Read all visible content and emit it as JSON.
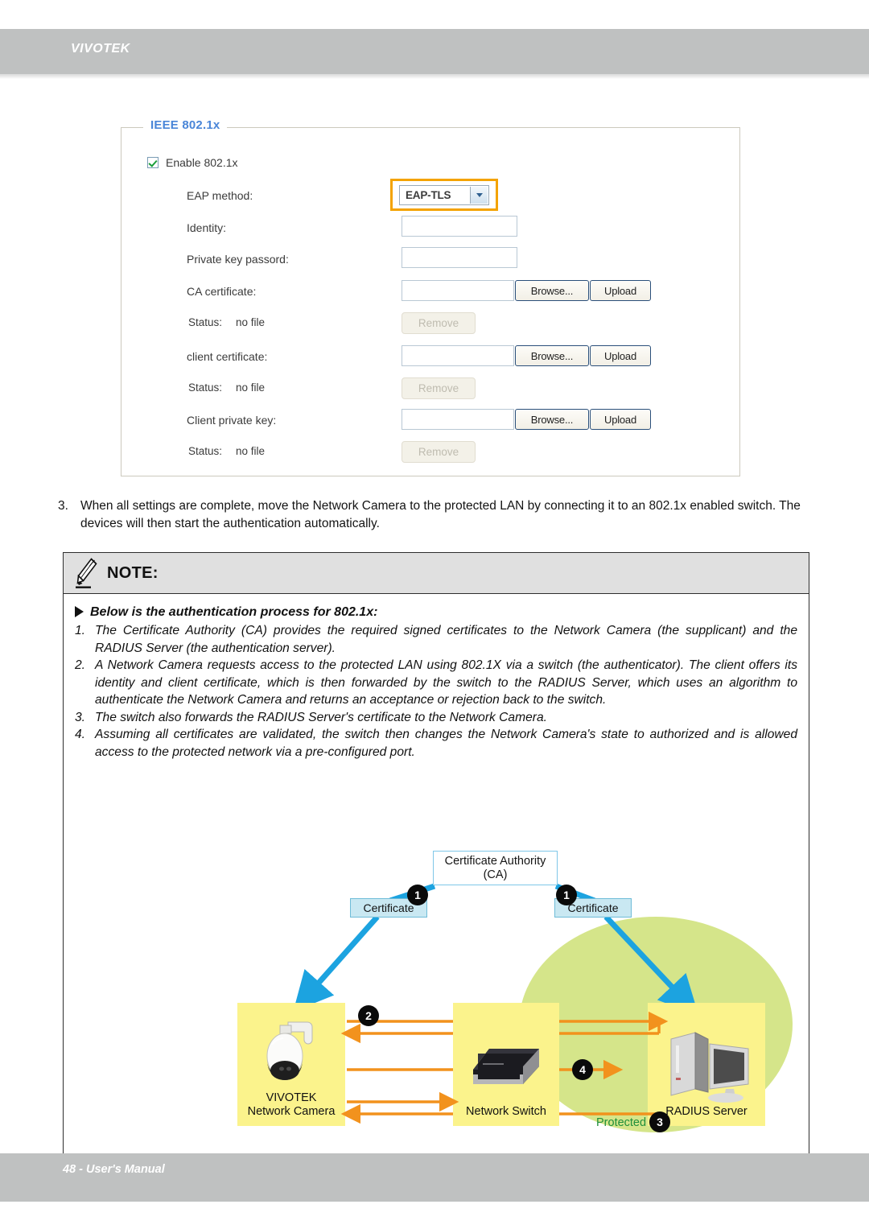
{
  "header": {
    "brand": "VIVOTEK"
  },
  "footer": {
    "text": "48 - User's Manual"
  },
  "settings": {
    "legend": "IEEE 802.1x",
    "enable_label": "Enable 802.1x",
    "enable_checked": true,
    "fields": {
      "eap_method_label": "EAP method:",
      "eap_method_value": "EAP-TLS",
      "identity_label": "Identity:",
      "identity_value": "",
      "private_key_label": "Private key passord:",
      "private_key_value": "",
      "ca_cert_label": "CA certificate:",
      "ca_cert_value": "",
      "client_cert_label": "client certificate:",
      "client_cert_value": "",
      "client_key_label": "Client private key:",
      "client_key_value": ""
    },
    "status_label": "Status:",
    "status_value": "no file",
    "buttons": {
      "browse": "Browse...",
      "upload": "Upload",
      "remove": "Remove"
    },
    "highlight_color": "#f4a300",
    "legend_color": "#4a86d8"
  },
  "step3": {
    "number": "3.",
    "text": "When all settings are complete, move the Network Camera to the protected LAN by connecting it to an 802.1x enabled switch. The devices will then start the authentication automatically."
  },
  "note": {
    "title": "NOTE:",
    "intro": "Below is the authentication process for 802.1x:",
    "items": [
      {
        "num": "1.",
        "text": "The Certificate Authority (CA) provides the required signed certificates to the Network Camera (the supplicant) and the RADIUS Server (the authentication server)."
      },
      {
        "num": "2.",
        "text": "A Network Camera requests access to the protected LAN using 802.1X via a switch (the authenticator). The client offers its identity and client certificate, which is then forwarded by the switch to the RADIUS Server, which uses an algorithm to authenticate the Network Camera and returns an acceptance or rejection back to the switch."
      },
      {
        "num": "3.",
        "text": "The switch also forwards the RADIUS Server's certificate to the Network Camera."
      },
      {
        "num": "4.",
        "text": "Assuming all certificates are validated, the switch then changes the Network Camera's state to authorized and is allowed access to the protected network via a pre-configured port."
      }
    ]
  },
  "diagram": {
    "ca_line1": "Certificate Authority",
    "ca_line2": "(CA)",
    "cert_left": "Certificate",
    "cert_right": "Certificate",
    "badge_1a": "1",
    "badge_1b": "1",
    "badge_2": "2",
    "badge_3": "3",
    "badge_4": "4",
    "camera_line1": "VIVOTEK",
    "camera_line2": "Network Camera",
    "switch_label": "Network Switch",
    "server_label": "RADIUS Server",
    "lan_label": "Protected LAN",
    "colors": {
      "lan_fill": "#d5e58a",
      "node_fill": "#fbf38c",
      "arrow_blue": "#1ca3e0",
      "arrow_orange": "#f2921d",
      "lan_text": "#1f8f3a"
    }
  }
}
